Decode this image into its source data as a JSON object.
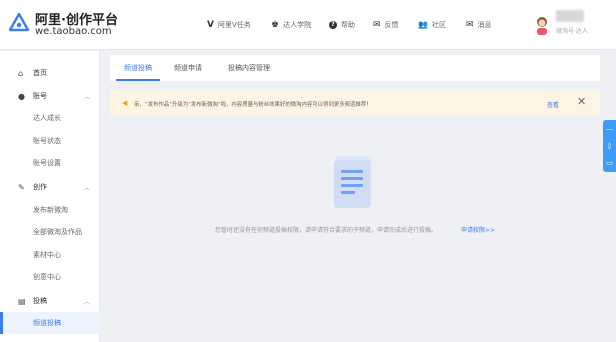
{
  "brand": {
    "title": "阿里·创作平台",
    "domain": "we.taobao.com"
  },
  "nav": [
    {
      "icon": "V",
      "label": "阿里V任务"
    },
    {
      "icon": "♚",
      "label": "达人学院"
    },
    {
      "icon": "?",
      "label": "帮助"
    },
    {
      "icon": "✉",
      "label": "反馈"
    },
    {
      "icon": "👥",
      "label": "社区"
    },
    {
      "icon": "✉",
      "label": "消息"
    }
  ],
  "user": {
    "role": "微淘号·达人"
  },
  "sidebar": {
    "home": "首页",
    "account": {
      "label": "账号",
      "items": [
        "达人成长",
        "账号状态",
        "账号设置"
      ]
    },
    "create": {
      "label": "创作",
      "items": [
        "发布新微淘",
        "全部微淘及作品",
        "素材中心",
        "创意中心"
      ]
    },
    "submit": {
      "label": "投稿",
      "items": [
        "频道投稿"
      ]
    }
  },
  "tabs": [
    "频道投稿",
    "频道申请",
    "投稿内容管理"
  ],
  "notice": {
    "text": "亲，“发布作品”升级为“发布新微淘”啦，内容质量与粉丝效果好的微淘内容可以得到更多频道推荐！",
    "link": "查看"
  },
  "empty": {
    "message": "您暂时还没有任何频道投稿权限，请申请符合要求的子频道，申请完成后进行投稿。",
    "link": "申请权限>>"
  },
  "colors": {
    "accent": "#3d7cf0",
    "notice_bg": "#fdf4e3",
    "float_bar": "#3d9cf5"
  }
}
